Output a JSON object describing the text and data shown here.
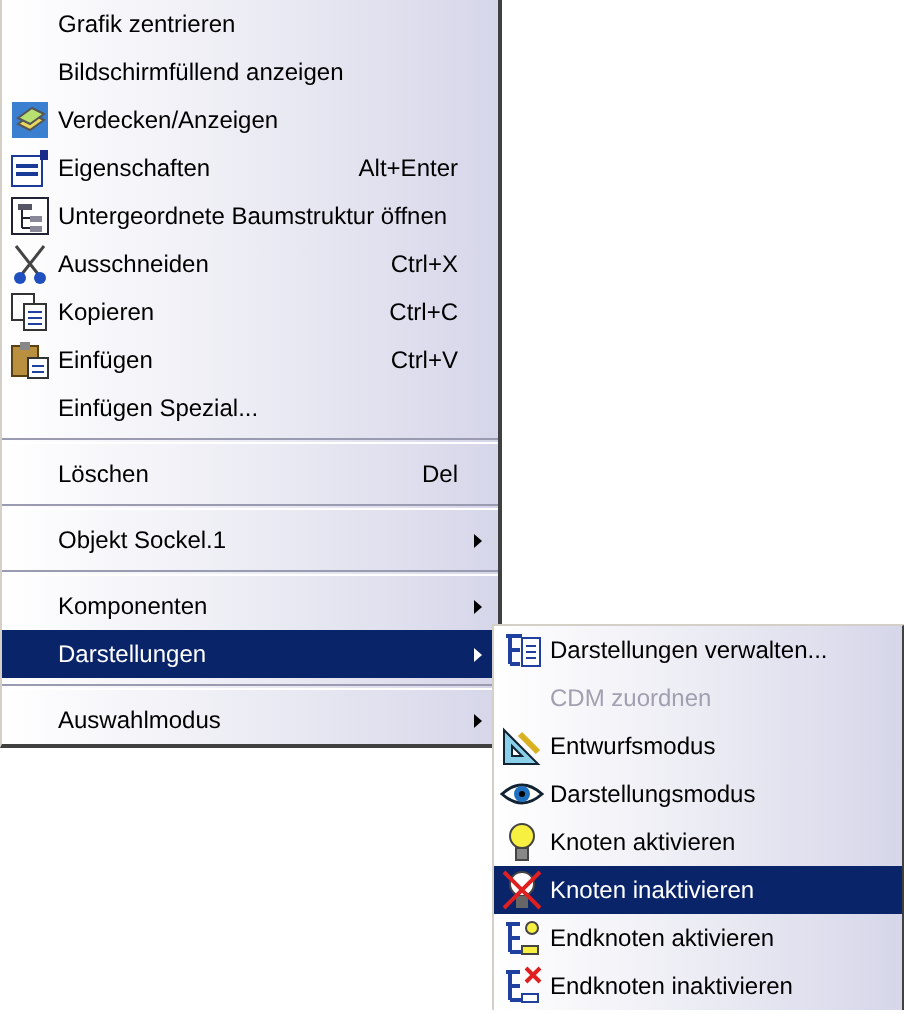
{
  "context_menu": {
    "items": [
      {
        "kind": "item",
        "label": "Grafik zentrieren"
      },
      {
        "kind": "item",
        "label": "Bildschirmfüllend anzeigen"
      },
      {
        "kind": "item",
        "label": "Verdecken/Anzeigen"
      },
      {
        "kind": "item",
        "label": "Eigenschaften",
        "shortcut": "Alt+Enter"
      },
      {
        "kind": "item",
        "label": "Untergeordnete Baumstruktur öffnen"
      },
      {
        "kind": "item",
        "label": "Ausschneiden",
        "shortcut": "Ctrl+X"
      },
      {
        "kind": "item",
        "label": "Kopieren",
        "shortcut": "Ctrl+C"
      },
      {
        "kind": "item",
        "label": "Einfügen",
        "shortcut": "Ctrl+V"
      },
      {
        "kind": "item",
        "label": "Einfügen Spezial..."
      },
      {
        "kind": "separator"
      },
      {
        "kind": "item",
        "label": "Löschen",
        "shortcut": "Del"
      },
      {
        "kind": "separator"
      },
      {
        "kind": "submenu",
        "label": "Objekt Sockel.1",
        "selected": false
      },
      {
        "kind": "separator"
      },
      {
        "kind": "submenu",
        "label": "Komponenten",
        "selected": false
      },
      {
        "kind": "submenu",
        "label": "Darstellungen",
        "selected": true
      },
      {
        "kind": "separator"
      },
      {
        "kind": "submenu",
        "label": "Auswahlmodus",
        "selected": false
      }
    ]
  },
  "submenu": {
    "items": [
      {
        "label": "Darstellungen verwalten...",
        "disabled": false,
        "selected": false
      },
      {
        "label": "CDM zuordnen",
        "disabled": true,
        "selected": false
      },
      {
        "label": "Entwurfsmodus",
        "disabled": false,
        "selected": false
      },
      {
        "label": "Darstellungsmodus",
        "disabled": false,
        "selected": false
      },
      {
        "label": "Knoten aktivieren",
        "disabled": false,
        "selected": false
      },
      {
        "label": "Knoten inaktivieren",
        "disabled": false,
        "selected": true
      },
      {
        "label": "Endknoten aktivieren",
        "disabled": false,
        "selected": false
      },
      {
        "label": "Endknoten inaktivieren",
        "disabled": false,
        "selected": false
      }
    ]
  }
}
